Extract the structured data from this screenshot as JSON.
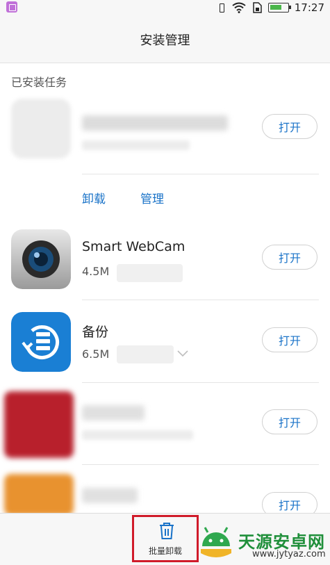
{
  "status_bar": {
    "time": "17:27",
    "icons": [
      "gallery-icon",
      "vibrate-icon",
      "wifi-icon",
      "sim-icon",
      "battery-icon"
    ]
  },
  "header": {
    "title": "安装管理"
  },
  "section": {
    "title": "已安装任务"
  },
  "apps": [
    {
      "name": "",
      "size": "",
      "button": "打开",
      "blurred": true,
      "icon_color": "#ececec"
    },
    {
      "name": "Smart WebCam",
      "size": "4.5M",
      "button": "打开",
      "blurred": false,
      "icon": "webcam-icon"
    },
    {
      "name": "备份",
      "size": "6.5M",
      "button": "打开",
      "blurred": false,
      "icon": "backup-icon",
      "icon_color": "#1a7fd4"
    },
    {
      "name": "",
      "size": "",
      "button": "打开",
      "blurred": true,
      "icon_color": "#b8202c"
    },
    {
      "name": "",
      "size": "",
      "button": "打开",
      "blurred": true,
      "icon_color": "#e8922f"
    }
  ],
  "actions": {
    "uninstall": "卸载",
    "manage": "管理"
  },
  "bottom_bar": {
    "batch_uninstall": "批量卸载",
    "highlight_color": "#d01b2a"
  },
  "watermark": {
    "title": "天源安卓网",
    "url": "www.jytyaz.com"
  },
  "colors": {
    "accent": "#1a73c8"
  }
}
